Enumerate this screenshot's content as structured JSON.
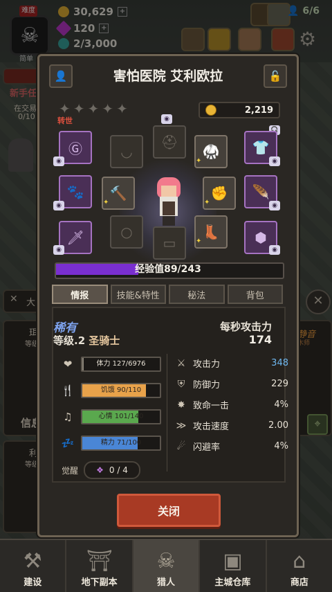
{
  "hud": {
    "badge_tag": "难度",
    "badge_sub": "简单",
    "gold": "30,629",
    "gems": "120",
    "population": "2/3,000",
    "people": "6/6"
  },
  "side": {
    "new_task": "新手任",
    "trade": "在交易",
    "trade_count": "0/10",
    "left1": "珥",
    "left1_sub": "等级",
    "left2": "信息",
    "left3": "利",
    "left3_sub": "等级",
    "right1": "静音",
    "right1_sub": "木师"
  },
  "modal": {
    "title": "害怕医院 艾利欧拉",
    "rebirth_label": "转世",
    "coins": "2,219",
    "xp_label": "经验值89/243",
    "xp_fraction": 0.366,
    "tabs": [
      "情报",
      "技能&特性",
      "秘法",
      "背包"
    ],
    "active_tab": 0,
    "rarity": "稀有",
    "level_prefix": "等级.2",
    "class_name": "圣骑士",
    "atk_per_sec_label": "每秒攻击力",
    "atk_per_sec_value": "174",
    "bars": [
      {
        "icon": "heart-icon",
        "text": "体力 127/6976",
        "fraction": 0.018,
        "color": "#8a8478"
      },
      {
        "icon": "fork-knife-icon",
        "text": "饥饿 90/110",
        "fraction": 0.82,
        "color": "#e8a24a"
      },
      {
        "icon": "music-note-icon",
        "text": "心情 101/140",
        "fraction": 0.72,
        "color": "#5aa84e"
      },
      {
        "icon": "sleep-icon",
        "text": "精力 71/100",
        "fraction": 0.71,
        "color": "#4a86d6"
      }
    ],
    "stats": [
      {
        "icon": "sword-icon",
        "name": "攻击力",
        "value": "348",
        "color": "#6fb8f0"
      },
      {
        "icon": "shield-icon",
        "name": "防御力",
        "value": "229",
        "color": "#e8e2d6"
      },
      {
        "icon": "crit-icon",
        "name": "致命一击",
        "value": "4%",
        "color": "#e8e2d6"
      },
      {
        "icon": "speed-icon",
        "name": "攻击速度",
        "value": "2.00",
        "color": "#e8e2d6"
      },
      {
        "icon": "dodge-icon",
        "name": "闪避率",
        "value": "4%",
        "color": "#e8e2d6"
      }
    ],
    "awaken_label": "觉醒",
    "awaken_value": "0 / 4",
    "close_label": "关闭"
  },
  "nav": [
    {
      "label": "建设",
      "icon": "hammer-icon"
    },
    {
      "label": "地下副本",
      "icon": "dungeon-gate-icon"
    },
    {
      "label": "猎人",
      "icon": "hunter-emblem-icon"
    },
    {
      "label": "主城仓库",
      "icon": "chest-icon"
    },
    {
      "label": "商店",
      "icon": "shop-icon"
    }
  ],
  "colors": {
    "xp_purple": "#7a2fd0",
    "close_red": "#a83a24",
    "rarity_blue": "#7ea3ee",
    "rebirth_red": "#e2513f"
  }
}
